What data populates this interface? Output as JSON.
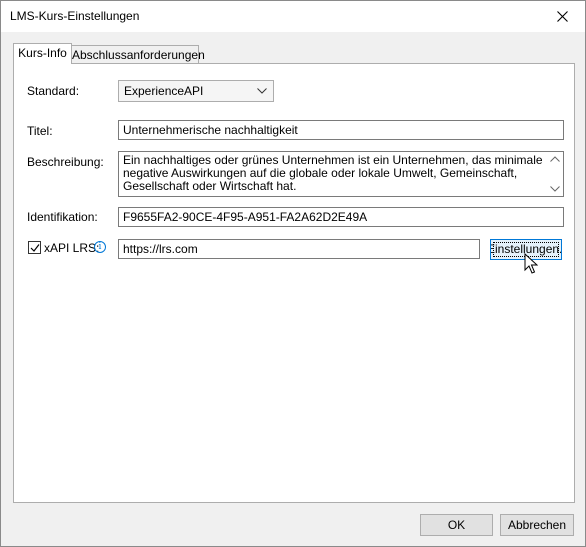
{
  "window": {
    "title": "LMS-Kurs-Einstellungen"
  },
  "tabs": [
    {
      "label": "Kurs-Info",
      "active": true
    },
    {
      "label": "Abschlussanforderungen",
      "active": false
    }
  ],
  "form": {
    "standard_label": "Standard:",
    "standard_value": "ExperienceAPI",
    "title_label": "Titel:",
    "title_value": "Unternehmerische nachhaltigkeit",
    "description_label": "Beschreibung:",
    "description_value": "Ein nachhaltiges oder grünes Unternehmen ist ein Unternehmen, das minimale negative Auswirkungen auf die globale oder lokale Umwelt, Gemeinschaft, Gesellschaft oder Wirtschaft hat.",
    "id_label": "Identifikation:",
    "id_value": "F9655FA2-90CE-4F95-A951-FA2A62D2E49A",
    "lrs_label": "xAPI LRS:",
    "lrs_checked": true,
    "lrs_value": "https://lrs.com",
    "settings_label": "Einstellungen..."
  },
  "footer": {
    "ok_label": "OK",
    "cancel_label": "Abbrechen"
  },
  "icons": {
    "close": "close-icon",
    "dropdown": "chevron-down-icon",
    "info": "info-icon",
    "check": "check-icon",
    "cursor": "mouse-pointer-icon"
  },
  "colors": {
    "accent": "#0078d7",
    "dialog_bg": "#f0f0f0",
    "panel_bg": "#ffffff"
  }
}
